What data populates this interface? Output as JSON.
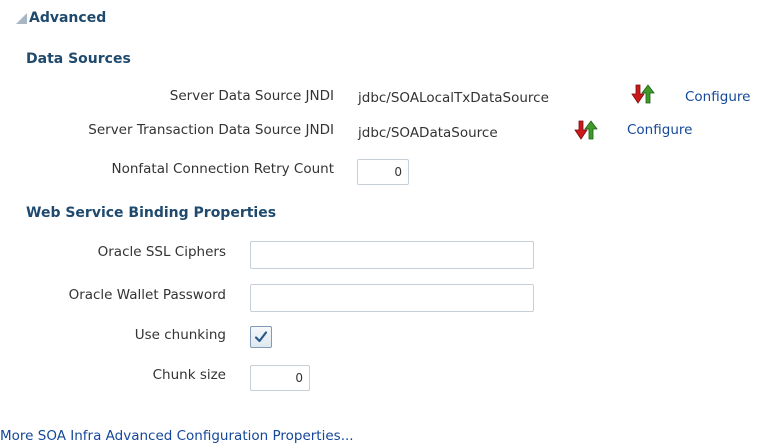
{
  "header": {
    "title": "Advanced"
  },
  "data_sources": {
    "heading": "Data Sources",
    "server_ds_label": "Server Data Source JNDI",
    "server_ds_value": "jdbc/SOALocalTxDataSource",
    "server_ds_configure": "Configure",
    "server_tx_label": "Server Transaction Data Source JNDI",
    "server_tx_value": "jdbc/SOADataSource",
    "server_tx_configure": "Configure",
    "retry_label": "Nonfatal Connection Retry Count",
    "retry_value": "0"
  },
  "web_service": {
    "heading": "Web Service Binding Properties",
    "ssl_ciphers_label": "Oracle SSL Ciphers",
    "ssl_ciphers_value": "",
    "wallet_password_label": "Oracle Wallet Password",
    "wallet_password_value": "",
    "chunking_label": "Use chunking",
    "chunking_checked": true,
    "chunk_size_label": "Chunk size",
    "chunk_size_value": "0"
  },
  "footer": {
    "more_link": "More SOA Infra Advanced Configuration Properties..."
  },
  "icons": {
    "disclosure": "triangle-expanded-icon",
    "datasource_action": "arrow-updown-icon"
  },
  "colors": {
    "heading": "#1f4a6e",
    "link": "#14479b",
    "arrow_red": "#cc1a1a",
    "arrow_green": "#3f9a2a"
  }
}
